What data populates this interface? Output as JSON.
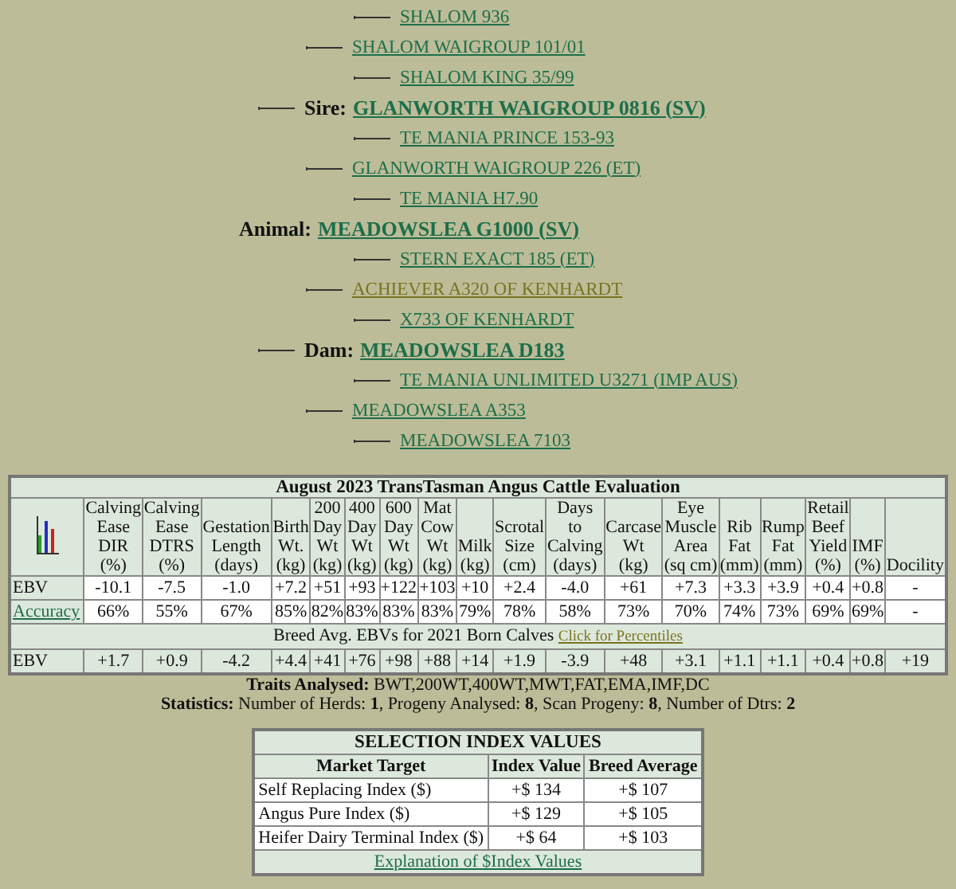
{
  "pedigree": {
    "label": "Animal:",
    "name": "MEADOWSLEA G1000 (SV)",
    "visited": false,
    "children": [
      {
        "label": "Sire:",
        "name": "GLANWORTH WAIGROUP 0816 (SV)",
        "visited": false,
        "children": [
          {
            "name": "SHALOM WAIGROUP 101/01",
            "visited": false,
            "children": [
              {
                "name": "SHALOM 936",
                "visited": false
              },
              {
                "name": "SHALOM KING 35/99",
                "visited": false
              }
            ]
          },
          {
            "name": "GLANWORTH WAIGROUP 226 (ET)",
            "visited": false,
            "children": [
              {
                "name": "TE MANIA PRINCE 153-93",
                "visited": false
              },
              {
                "name": "TE MANIA H7.90",
                "visited": false
              }
            ]
          }
        ]
      },
      {
        "label": "Dam:",
        "name": "MEADOWSLEA D183",
        "visited": false,
        "children": [
          {
            "name": "ACHIEVER A320 OF KENHARDT",
            "visited": true,
            "children": [
              {
                "name": "STERN EXACT 185 (ET)",
                "visited": false
              },
              {
                "name": "X733 OF KENHARDT",
                "visited": false
              }
            ]
          },
          {
            "name": "MEADOWSLEA A353",
            "visited": false,
            "children": [
              {
                "name": "TE MANIA UNLIMITED U3271 (IMP AUS)",
                "visited": false
              },
              {
                "name": "MEADOWSLEA 7103",
                "visited": false
              }
            ]
          }
        ]
      }
    ]
  },
  "evaluation": {
    "title": "August 2023 TransTasman Angus Cattle Evaluation",
    "columns": [
      "Calving\nEase\nDIR\n(%)",
      "Calving\nEase\nDTRS\n(%)",
      "Gestation\nLength\n(days)",
      "Birth\nWt.\n(kg)",
      "200\nDay\nWt\n(kg)",
      "400\nDay\nWt\n(kg)",
      "600\nDay\nWt\n(kg)",
      "Mat\nCow\nWt\n(kg)",
      "Milk\n(kg)",
      "Scrotal\nSize\n(cm)",
      "Days\nto\nCalving\n(days)",
      "Carcase\nWt\n(kg)",
      "Eye\nMuscle\nArea\n(sq cm)",
      "Rib\nFat\n(mm)",
      "Rump\nFat\n(mm)",
      "Retail\nBeef\nYield\n(%)",
      "IMF\n(%)",
      "Docility"
    ],
    "rows": [
      {
        "label": "EBV",
        "kind": "text",
        "values": [
          "-10.1",
          "-7.5",
          "-1.0",
          "+7.2",
          "+51",
          "+93",
          "+122",
          "+103",
          "+10",
          "+2.4",
          "-4.0",
          "+61",
          "+7.3",
          "+3.3",
          "+3.9",
          "+0.4",
          "+0.8",
          "-"
        ]
      },
      {
        "label": "Accuracy",
        "kind": "link",
        "values": [
          "66%",
          "55%",
          "67%",
          "85%",
          "82%",
          "83%",
          "83%",
          "83%",
          "79%",
          "78%",
          "58%",
          "73%",
          "70%",
          "74%",
          "73%",
          "69%",
          "69%",
          "-"
        ]
      }
    ],
    "breed_note": {
      "text": "Breed Avg. EBVs for 2021 Born Calves",
      "link": "Click for Percentiles"
    },
    "breed_rows": [
      {
        "label": "EBV",
        "kind": "text",
        "values": [
          "+1.7",
          "+0.9",
          "-4.2",
          "+4.4",
          "+41",
          "+76",
          "+98",
          "+88",
          "+14",
          "+1.9",
          "-3.9",
          "+48",
          "+3.1",
          "+1.1",
          "+1.1",
          "+0.4",
          "+0.8",
          "+19"
        ]
      }
    ]
  },
  "traits": "**Traits Analysed:** BWT,200WT,400WT,MWT,FAT,EMA,IMF,DC",
  "statistics": "**Statistics:** Number of Herds: **1**, Progeny Analysed: **8**, Scan Progeny: **8**, Number of Dtrs: **2**",
  "index_table": {
    "title": "SELECTION INDEX VALUES",
    "columns": [
      "Market Target",
      "Index Value",
      "Breed Average"
    ],
    "rows": [
      [
        "Self Replacing Index ($)",
        "+$ 134",
        "+$ 107"
      ],
      [
        "Angus Pure Index ($)",
        "+$ 129",
        "+$ 105"
      ],
      [
        "Heifer Dairy Terminal Index ($)",
        "+$ 64",
        "+$ 103"
      ]
    ],
    "footer_link": "Explanation of $Index Values"
  }
}
